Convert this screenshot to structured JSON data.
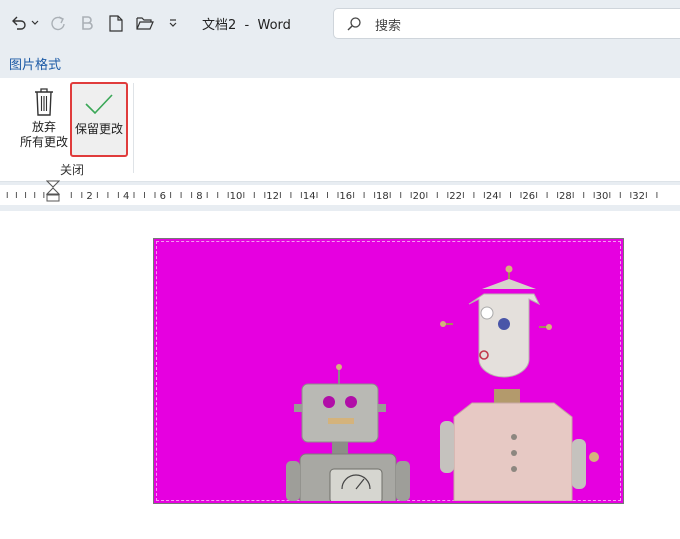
{
  "title_bar": {
    "document_title": "文档2  -  Word",
    "search_placeholder": "搜索",
    "icons": [
      "undo-icon",
      "chevron-down-icon",
      "redo-icon",
      "bold-icon",
      "new-document-icon",
      "open-folder-icon",
      "customize-toolbar-icon"
    ]
  },
  "tabs": {
    "active_label": "图片格式"
  },
  "ribbon": {
    "discard_label_line1": "放弃",
    "discard_label_line2": "所有更改",
    "keep_label": "保留更改",
    "group_label": "关闭"
  },
  "ruler": {
    "labels": [
      "2",
      "4",
      "6",
      "8",
      "10",
      "12",
      "14",
      "16",
      "18",
      "20",
      "22",
      "24",
      "26",
      "28",
      "30",
      "32"
    ]
  },
  "picture": {
    "background_color": "#e600e0",
    "description_icon": "robots-image"
  },
  "colors": {
    "chrome": "#e8edf2",
    "accent_tab": "#1c5aa6",
    "highlight_border": "#e03c3c",
    "check_green": "#3aa757"
  }
}
